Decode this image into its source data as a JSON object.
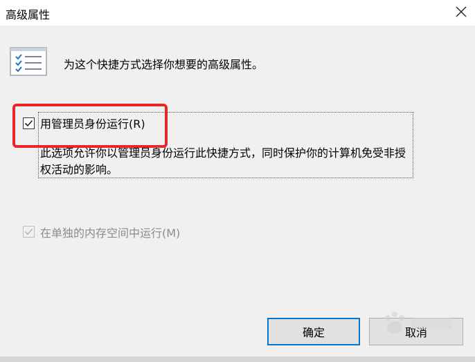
{
  "window": {
    "title": "高级属性",
    "close_icon": "close-icon"
  },
  "header": {
    "icon": "properties-list-icon",
    "text": "为这个快捷方式选择你想要的高级属性。"
  },
  "options": [
    {
      "label": "用管理员身份运行(R)",
      "checked": true,
      "enabled": true,
      "description": "此选项允许你以管理员身份运行此快捷方式，同时保护你的计算机免受非授权活动的影响。"
    },
    {
      "label": "在单独的内存空间中运行(M)",
      "checked": true,
      "enabled": false
    }
  ],
  "buttons": {
    "ok_label": "确定",
    "cancel_label": "取消"
  },
  "colors": {
    "highlight": "#e8262a",
    "accent": "#0078d7",
    "disabled_text": "#8c8c8c"
  }
}
